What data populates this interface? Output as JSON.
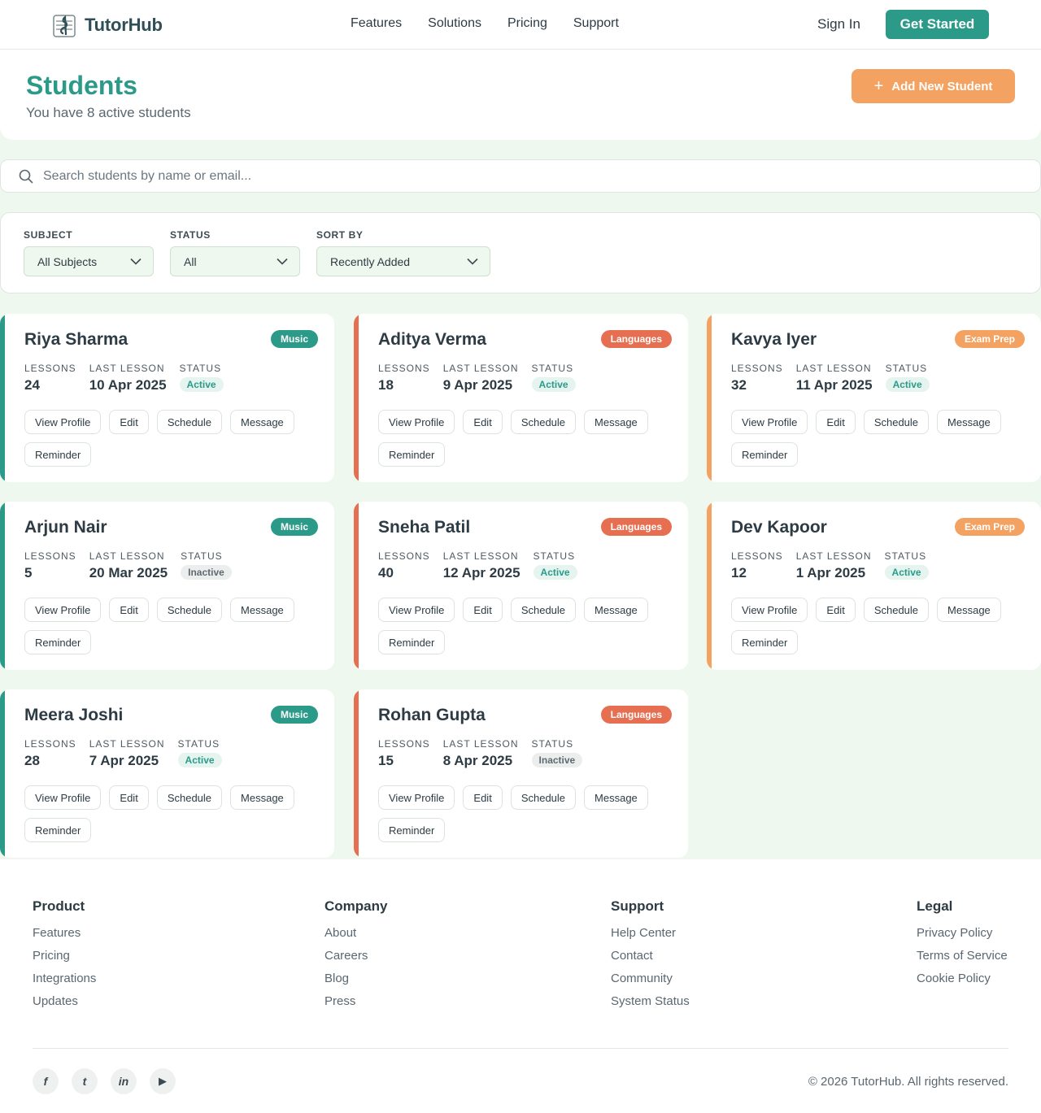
{
  "nav": {
    "brand": "TutorHub",
    "links": [
      "Features",
      "Solutions",
      "Pricing",
      "Support"
    ],
    "sign_in": "Sign In",
    "get_started": "Get Started"
  },
  "header": {
    "title": "Students",
    "subtitle": "You have 8 active students",
    "add_button": "Add New Student"
  },
  "search": {
    "placeholder": "Search students by name or email..."
  },
  "filters": {
    "subject": {
      "label": "SUBJECT",
      "value": "All Subjects"
    },
    "status": {
      "label": "STATUS",
      "value": "All"
    },
    "sort": {
      "label": "SORT BY",
      "value": "Recently Added"
    }
  },
  "card_labels": {
    "lessons": "LESSONS",
    "last_lesson": "LAST LESSON",
    "status": "STATUS"
  },
  "actions": [
    "View Profile",
    "Edit",
    "Schedule",
    "Message",
    "Reminder"
  ],
  "colors": {
    "music": "#2b9a89",
    "languages": "#e76f51",
    "exam": "#f4a261",
    "brand": "#2b9a89",
    "cta": "#f4a261"
  },
  "students": [
    {
      "name": "Riya Sharma",
      "subject": "Music",
      "lessons": "24",
      "last": "10 Apr 2025",
      "status": "Active"
    },
    {
      "name": "Aditya Verma",
      "subject": "Languages",
      "lessons": "18",
      "last": "9 Apr 2025",
      "status": "Active"
    },
    {
      "name": "Kavya Iyer",
      "subject": "Exam Prep",
      "lessons": "32",
      "last": "11 Apr 2025",
      "status": "Active"
    },
    {
      "name": "Arjun Nair",
      "subject": "Music",
      "lessons": "5",
      "last": "20 Mar 2025",
      "status": "Inactive"
    },
    {
      "name": "Sneha Patil",
      "subject": "Languages",
      "lessons": "40",
      "last": "12 Apr 2025",
      "status": "Active"
    },
    {
      "name": "Dev Kapoor",
      "subject": "Exam Prep",
      "lessons": "12",
      "last": "1 Apr 2025",
      "status": "Active"
    },
    {
      "name": "Meera Joshi",
      "subject": "Music",
      "lessons": "28",
      "last": "7 Apr 2025",
      "status": "Active"
    },
    {
      "name": "Rohan Gupta",
      "subject": "Languages",
      "lessons": "15",
      "last": "8 Apr 2025",
      "status": "Inactive"
    }
  ],
  "footer": {
    "columns": [
      {
        "title": "Product",
        "links": [
          "Features",
          "Pricing",
          "Integrations",
          "Updates"
        ]
      },
      {
        "title": "Company",
        "links": [
          "About",
          "Careers",
          "Blog",
          "Press"
        ]
      },
      {
        "title": "Support",
        "links": [
          "Help Center",
          "Contact",
          "Community",
          "System Status"
        ]
      },
      {
        "title": "Legal",
        "links": [
          "Privacy Policy",
          "Terms of Service",
          "Cookie Policy"
        ]
      }
    ],
    "social": [
      {
        "name": "facebook-icon",
        "glyph": "f"
      },
      {
        "name": "twitter-icon",
        "glyph": "t"
      },
      {
        "name": "linkedin-icon",
        "glyph": "in"
      },
      {
        "name": "youtube-icon",
        "glyph": "▶"
      }
    ],
    "copyright": "© 2026 TutorHub. All rights reserved."
  }
}
